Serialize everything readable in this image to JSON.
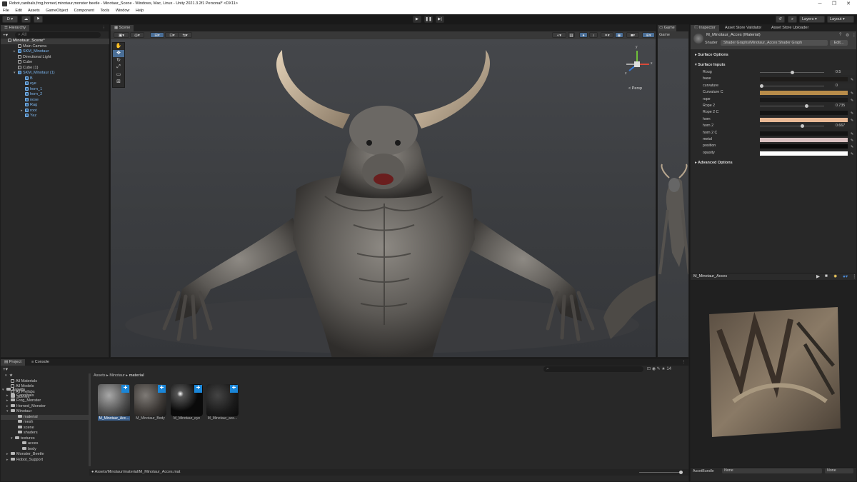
{
  "window": {
    "title": "Robot,canibals,frog,horned,minotaur,monster beetle - Minotaur_Scene - Windows, Mac, Linux - Unity 2021.3.2f1 Personal* <DX11>",
    "controls": [
      "─",
      "❐",
      "✕"
    ]
  },
  "menu": [
    "File",
    "Edit",
    "Assets",
    "GameObject",
    "Component",
    "Tools",
    "Window",
    "Help"
  ],
  "toolbar": {
    "account": "D ▾",
    "layers": "Layers",
    "layout": "Layout"
  },
  "hierarchy": {
    "tab": "Hierarchy",
    "search_placeholder": "All",
    "items": [
      {
        "label": "Minotaur_Scene*",
        "style": "scene"
      },
      {
        "label": "Main Camera",
        "style": "obj"
      },
      {
        "label": "SKM_Minotaur",
        "style": "prefab",
        "arrow": "▸"
      },
      {
        "label": "Directional Light",
        "style": "obj"
      },
      {
        "label": "Cube",
        "style": "obj"
      },
      {
        "label": "Cube (1)",
        "style": "obj"
      },
      {
        "label": "SKM_Minotaur (1)",
        "style": "prefab",
        "arrow": "▾"
      },
      {
        "label": "B",
        "style": "prefab"
      },
      {
        "label": "eye",
        "style": "prefab"
      },
      {
        "label": "horn_1",
        "style": "prefab"
      },
      {
        "label": "horn_2",
        "style": "prefab"
      },
      {
        "label": "nose",
        "style": "prefab"
      },
      {
        "label": "Rag",
        "style": "prefab"
      },
      {
        "label": "root",
        "style": "prefab",
        "arrow": "▸"
      },
      {
        "label": "Yaz",
        "style": "prefab"
      }
    ]
  },
  "scene": {
    "tab": "Scene",
    "persp": "< Persp",
    "gizmo_axes": [
      "y",
      "x",
      "z"
    ]
  },
  "game": {
    "tab": "Game",
    "sub": "Game"
  },
  "inspector": {
    "tabs": [
      "Inspector",
      "Asset Store Validator",
      "Asset Store Uploader"
    ],
    "material_name": "M_Minotaur_Acces (Material)",
    "shader_label": "Shader",
    "shader_value": "Shader Graphs/Minotaur_Acces Shader Graph",
    "edit_label": "Edit...",
    "surface_options": "Surface Options",
    "surface_inputs": "Surface Inputs",
    "advanced_options": "Advanced Options",
    "properties": [
      {
        "name": "Roug",
        "kind": "slider",
        "value": "0.5",
        "fraction": 0.5
      },
      {
        "name": "base",
        "kind": "color",
        "color": "#1e1c1a"
      },
      {
        "name": "curvature",
        "kind": "slider",
        "value": "0",
        "fraction": 0.0
      },
      {
        "name": "Curvature C",
        "kind": "color",
        "color": "#b88c4a"
      },
      {
        "name": "rope",
        "kind": "color",
        "color": "#1a1a1a"
      },
      {
        "name": "Rope 2",
        "kind": "slider",
        "value": "0.735",
        "fraction": 0.735
      },
      {
        "name": "Rope 2 C",
        "kind": "color",
        "color": "#141414"
      },
      {
        "name": "horn",
        "kind": "color",
        "color": "#e8b895"
      },
      {
        "name": "horn 2",
        "kind": "slider",
        "value": "0.667",
        "fraction": 0.667
      },
      {
        "name": "horn 2 C",
        "kind": "color",
        "color": "#141414"
      },
      {
        "name": "metal",
        "kind": "color",
        "color": "#d9c1c1"
      },
      {
        "name": "position",
        "kind": "color",
        "color": "#0a0a0a"
      },
      {
        "name": "opasity",
        "kind": "color",
        "color": "#ffffff"
      }
    ],
    "preview_title": "M_Minotaur_Acces",
    "assetbundle_label": "AssetBundle",
    "assetbundle_value": "None",
    "assetbundle_variant": "None"
  },
  "project": {
    "tabs": [
      "Project",
      "Console"
    ],
    "favorites": [
      "All Materials",
      "All Models",
      "All Prefabs",
      "Scenes"
    ],
    "tree": [
      {
        "label": "Assets",
        "arrow": "▾",
        "bold": true
      },
      {
        "label": "Cannibals",
        "arrow": "▸"
      },
      {
        "label": "Frog_Monster",
        "arrow": "▸"
      },
      {
        "label": "Horned_Monster",
        "arrow": "▸"
      },
      {
        "label": "Minotaur",
        "arrow": "▾"
      },
      {
        "label": "material",
        "arrow": "",
        "selected": true
      },
      {
        "label": "mesh",
        "arrow": ""
      },
      {
        "label": "scene",
        "arrow": ""
      },
      {
        "label": "shaders",
        "arrow": ""
      },
      {
        "label": "textures",
        "arrow": "▾"
      },
      {
        "label": "acces",
        "arrow": ""
      },
      {
        "label": "body",
        "arrow": ""
      },
      {
        "label": "Monster_Beetle",
        "arrow": "▸"
      },
      {
        "label": "Robot_Support",
        "arrow": "▸"
      }
    ],
    "breadcrumb": [
      "Assets",
      "Minotaur",
      "material"
    ],
    "assets": [
      "M_Minotaur_Acc...",
      "M_Minotaur_Body",
      "M_Minotaur_eye",
      "M_Minotaur_ace..."
    ],
    "path": "Assets/Minotaur/material/M_Minotaur_Acces.mat",
    "count": "14"
  },
  "colors": {
    "accent": "#1a86d8",
    "prefab_text": "#7cb6ef",
    "panel_bg": "#282828",
    "scene_bg": "#3b3d40"
  }
}
